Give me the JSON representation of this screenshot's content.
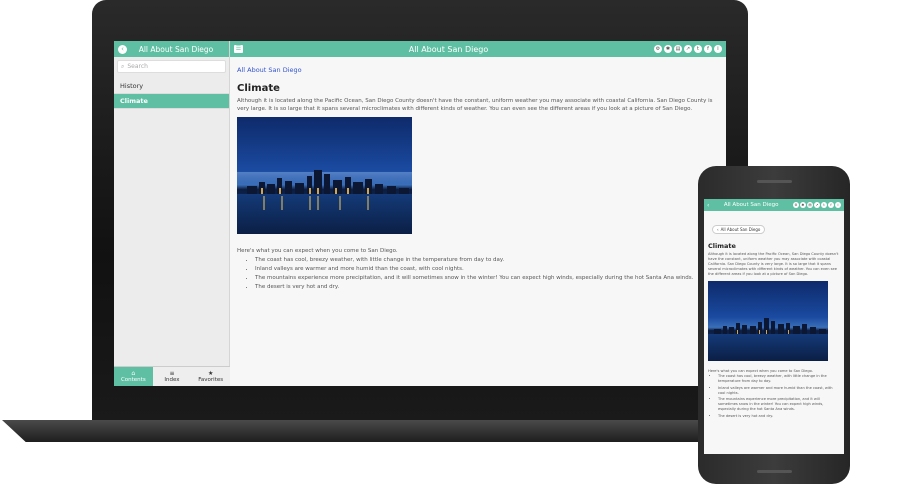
{
  "app": {
    "title": "All About San Diego",
    "accent_color": "#5fbfa3"
  },
  "sidebar": {
    "search_placeholder": "Search",
    "items": [
      {
        "label": "History",
        "active": false
      },
      {
        "label": "Climate",
        "active": true
      }
    ],
    "tabs": [
      {
        "label": "Contents",
        "icon": "home-icon",
        "active": true
      },
      {
        "label": "Index",
        "icon": "list-icon",
        "active": false
      },
      {
        "label": "Favorites",
        "icon": "star-icon",
        "active": false
      }
    ]
  },
  "toolbar": {
    "icons": [
      "gear-icon",
      "settings-icon",
      "print-icon",
      "share-icon",
      "twitter-icon",
      "facebook-icon",
      "info-icon"
    ]
  },
  "page": {
    "breadcrumb": "All About San Diego",
    "heading": "Climate",
    "paragraph": "Although it is located along the Pacific Ocean, San Diego County doesn't have the constant, uniform weather you may associate with coastal California. San Diego County is very large. It is so large that it spans several microclimates with different kinds of weather. You can even see the different areas if you look at a picture of San Diego.",
    "intro": "Here's what you can expect when you come to San Diego.",
    "bullets": [
      "The coast has cool, breezy weather, with little change in the temperature from day to day.",
      "Inland valleys are warmer and more humid than the coast, with cool nights.",
      "The mountains experience more precipitation, and it will sometimes snow in the winter! You can expect high winds, especially during the hot Santa Ana winds.",
      "The desert is very hot and dry."
    ]
  },
  "phone": {
    "title": "All About San Diego",
    "chip": "All About San Diego"
  }
}
